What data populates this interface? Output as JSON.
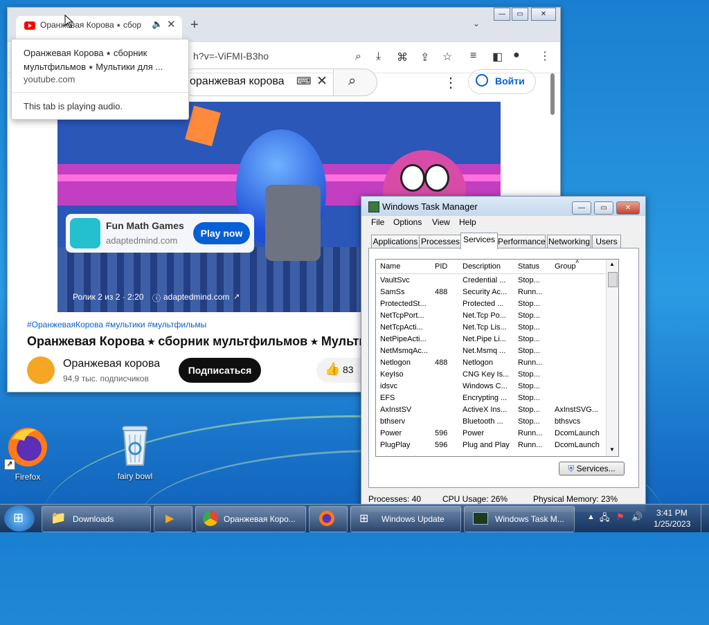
{
  "chrome": {
    "tab_title": "Оранжевая Корова ⭑ сбор",
    "url": "h?v=-ViFMI-B3ho",
    "tooltip": {
      "title": "Оранжевая Корова ⭑ сборник мультфильмов ⭑ Мультики для ...",
      "domain": "youtube.com",
      "audio_note": "This tab is playing audio."
    }
  },
  "youtube": {
    "search_value": "оранжевая корова",
    "signin_label": "Войти",
    "ad": {
      "title": "Fun Math Games",
      "domain": "adaptedmind.com",
      "cta": "Play now",
      "counter": "Ролик 2 из 2 · 2:20",
      "link": "adaptedmind.com"
    },
    "hashtags": "#ОранжеваяКорова #мультики #мультфильмы",
    "video_title": "Оранжевая Корова ⭑ сборник мультфильмов ⭑ Мульти",
    "channel_name": "Оранжевая корова",
    "subscribers": "94,9 тыс. подписчиков",
    "subscribe_label": "Подписаться",
    "likes": "83"
  },
  "desktop": {
    "icons": [
      {
        "label": "Firefox"
      },
      {
        "label": "fairy bowl"
      }
    ]
  },
  "task_manager": {
    "title": "Windows Task Manager",
    "menu": [
      "File",
      "Options",
      "View",
      "Help"
    ],
    "tabs": [
      "Applications",
      "Processes",
      "Services",
      "Performance",
      "Networking",
      "Users"
    ],
    "active_tab": "Services",
    "columns": [
      "Name",
      "PID",
      "Description",
      "Status",
      "Group"
    ],
    "rows": [
      {
        "name": "VaultSvc",
        "pid": "",
        "desc": "Credential ...",
        "status": "Stop...",
        "group": ""
      },
      {
        "name": "SamSs",
        "pid": "488",
        "desc": "Security Ac...",
        "status": "Runn...",
        "group": ""
      },
      {
        "name": "ProtectedSt...",
        "pid": "",
        "desc": "Protected ...",
        "status": "Stop...",
        "group": ""
      },
      {
        "name": "NetTcpPort...",
        "pid": "",
        "desc": "Net.Tcp Po...",
        "status": "Stop...",
        "group": ""
      },
      {
        "name": "NetTcpActi...",
        "pid": "",
        "desc": "Net.Tcp Lis...",
        "status": "Stop...",
        "group": ""
      },
      {
        "name": "NetPipeActi...",
        "pid": "",
        "desc": "Net.Pipe Li...",
        "status": "Stop...",
        "group": ""
      },
      {
        "name": "NetMsmqAc...",
        "pid": "",
        "desc": "Net.Msmq ...",
        "status": "Stop...",
        "group": ""
      },
      {
        "name": "Netlogon",
        "pid": "488",
        "desc": "Netlogon",
        "status": "Runn...",
        "group": ""
      },
      {
        "name": "KeyIso",
        "pid": "",
        "desc": "CNG Key Is...",
        "status": "Stop...",
        "group": ""
      },
      {
        "name": "idsvc",
        "pid": "",
        "desc": "Windows C...",
        "status": "Stop...",
        "group": ""
      },
      {
        "name": "EFS",
        "pid": "",
        "desc": "Encrypting ...",
        "status": "Stop...",
        "group": ""
      },
      {
        "name": "AxInstSV",
        "pid": "",
        "desc": "ActiveX Ins...",
        "status": "Stop...",
        "group": "AxInstSVG..."
      },
      {
        "name": "bthserv",
        "pid": "",
        "desc": "Bluetooth ...",
        "status": "Stop...",
        "group": "bthsvcs"
      },
      {
        "name": "Power",
        "pid": "596",
        "desc": "Power",
        "status": "Runn...",
        "group": "DcomLaunch"
      },
      {
        "name": "PlugPlay",
        "pid": "596",
        "desc": "Plug and Play",
        "status": "Runn...",
        "group": "DcomLaunch"
      }
    ],
    "services_button": "Services...",
    "status": {
      "processes": "Processes: 40",
      "cpu": "CPU Usage: 26%",
      "memory": "Physical Memory: 23%"
    }
  },
  "taskbar": {
    "items": [
      {
        "label": "Downloads"
      },
      {
        "label": "Оранжевая Коро..."
      },
      {
        "label": "Windows Update"
      },
      {
        "label": "Windows Task M..."
      }
    ],
    "time": "3:41 PM",
    "date": "1/25/2023"
  }
}
